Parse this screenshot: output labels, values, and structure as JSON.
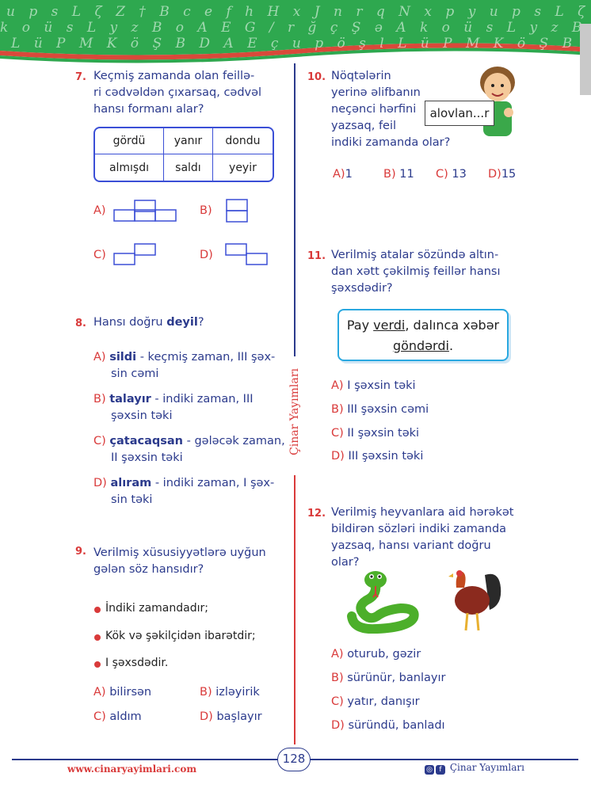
{
  "header": {
    "pattern_rows": [
      "u p s L ζ Z † B c e f h H x J n r q N x p y u p s L ζ Z † B c e f h H",
      "k o ü s L y z B o A E G / r ğ ç Ş ə A k o ü s L y z B o A E G / r ğ ş",
      "L ü P M K ö Ş B D A E ç u p ö ş l L ü P M K ö Ş B D A E ç u P"
    ],
    "colors": {
      "green": "#2ea84f",
      "green_dark": "#1f8a3d",
      "stripe": "#d9493a"
    }
  },
  "q7": {
    "number": "7.",
    "text": [
      "Keçmiş zamanda olan feillə-",
      "ri cədvəldən çıxarsaq, cədvəl",
      "hansı formanı alar?"
    ],
    "table": [
      [
        "gördü",
        "yanır",
        "dondu"
      ],
      [
        "almışdı",
        "saldı",
        "yeyir"
      ]
    ],
    "options": [
      "A)",
      "B)",
      "C)",
      "D)"
    ]
  },
  "q8": {
    "number": "8.",
    "text_prefix": "Hansı doğru ",
    "text_bold": "deyil",
    "text_suffix": "?",
    "options": [
      {
        "letter": "A)",
        "bold": "sildi",
        "line1": " - keçmiş zaman, III şəx-",
        "line2": "sin cəmi"
      },
      {
        "letter": "B)",
        "bold": "talayır",
        "line1": " - indiki zaman, III",
        "line2": "şəxsin təki"
      },
      {
        "letter": "C)",
        "bold": "çatacaqsan",
        "line1": " - gələcək zaman,",
        "line2": "II şəxsin təki"
      },
      {
        "letter": "D)",
        "bold": "alıram",
        "line1": " - indiki zaman, I şəx-",
        "line2": "sin təki"
      }
    ]
  },
  "q9": {
    "number": "9.",
    "text": [
      "Verilmiş xüsusiyyətlərə uyğun",
      "gələn söz hansıdır?"
    ],
    "bullets": [
      "İndiki zamandadır;",
      "Kök və şəkilçidən ibarətdir;",
      "I şəxsdədir."
    ],
    "options": [
      {
        "letter": "A)",
        "text": "bilirsən"
      },
      {
        "letter": "B)",
        "text": "izləyirik"
      },
      {
        "letter": "C)",
        "text": "aldım"
      },
      {
        "letter": "D)",
        "text": "başlayır"
      }
    ]
  },
  "q10": {
    "number": "10.",
    "text": [
      "Nöqtələrin",
      "yerinə əlifbanın",
      "neçənci hərfini",
      "yazsaq, feil",
      "indiki zamanda olar?"
    ],
    "card_text": "alovlan...r",
    "options": [
      {
        "letter": "A)",
        "text": "1"
      },
      {
        "letter": "B)",
        "text": "11"
      },
      {
        "letter": "C)",
        "text": "13"
      },
      {
        "letter": "D)",
        "text": "15"
      }
    ]
  },
  "q11": {
    "number": "11.",
    "text": [
      "Verilmiş atalar sözündə altın-",
      "dan xətt çəkilmiş feillər hansı",
      "şəxsdədir?"
    ],
    "proverb": {
      "p1": "Pay ",
      "u1": "verdi",
      "p2": ", dalınca xəbər",
      "u2": "göndərdi",
      "p3": "."
    },
    "options": [
      {
        "letter": "A)",
        "text": "I şəxsin təki"
      },
      {
        "letter": "B)",
        "text": "III şəxsin cəmi"
      },
      {
        "letter": "C)",
        "text": "II şəxsin təki"
      },
      {
        "letter": "D)",
        "text": "III şəxsin təki"
      }
    ]
  },
  "q12": {
    "number": "12.",
    "text": [
      "Verilmiş heyvanlara aid hərəkət",
      "bildirən sözləri indiki zamanda",
      "yazsaq, hansı variant doğru",
      "olar?"
    ],
    "options": [
      {
        "letter": "A)",
        "text": "oturub, gəzir"
      },
      {
        "letter": "B)",
        "text": "sürünür, banlayır"
      },
      {
        "letter": "C)",
        "text": "yatır, danışır"
      },
      {
        "letter": "D)",
        "text": "süründü, banladı"
      }
    ]
  },
  "side_brand": "Çinar Yayımları",
  "footer": {
    "page": "128",
    "url": "www.cinaryayimlari.com",
    "social_name": "Çinar Yayımları",
    "icons": [
      "instagram-icon",
      "facebook-icon"
    ]
  }
}
